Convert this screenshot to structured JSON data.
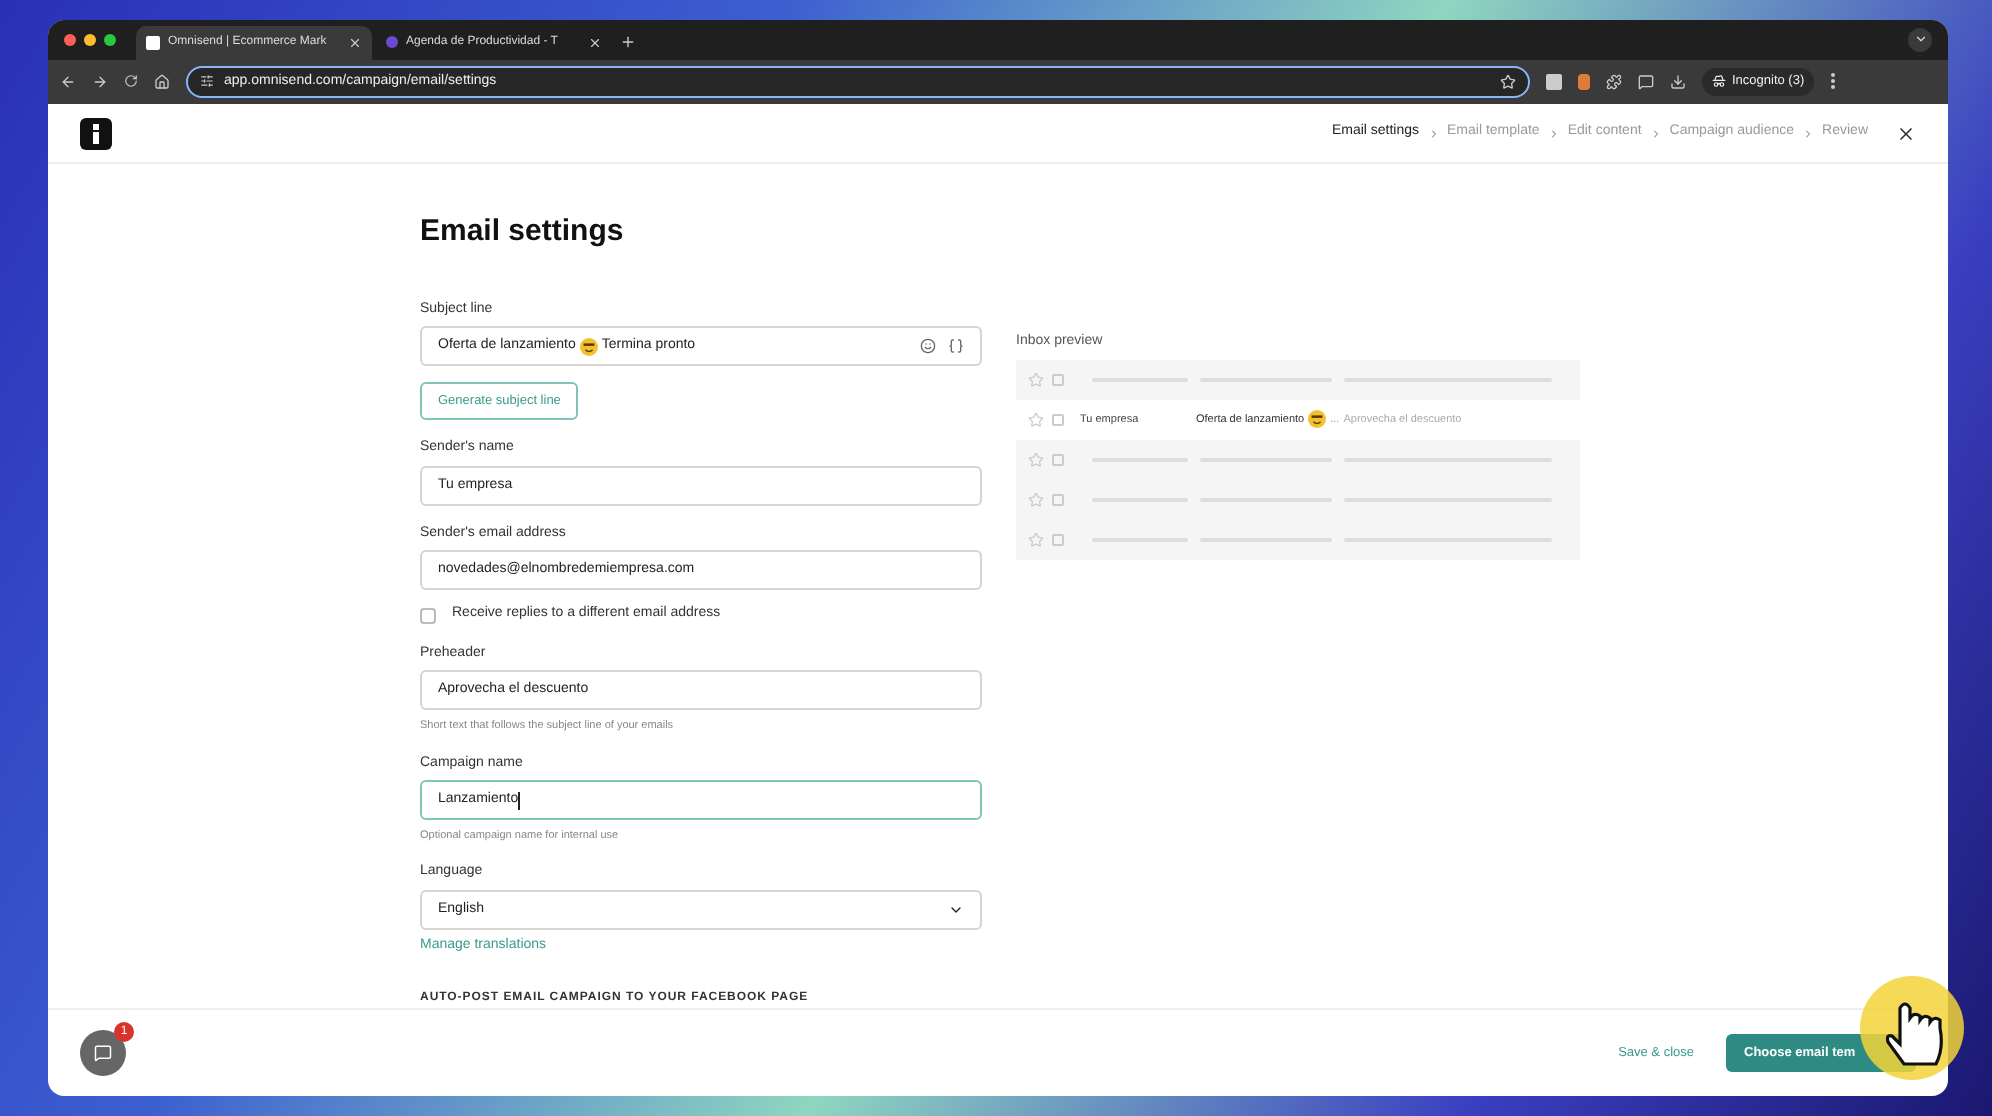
{
  "browser": {
    "tabs": [
      {
        "title": "Omnisend | Ecommerce Mark",
        "selected": true,
        "kind": "logo"
      },
      {
        "title": "Agenda de Productividad - T",
        "selected": false,
        "kind": "dot"
      }
    ],
    "url": "app.omnisend.com/campaign/email/settings",
    "profile": "Incognito (3)"
  },
  "steps": [
    {
      "label": "Email settings",
      "selected": true
    },
    {
      "label": "Email template",
      "selected": false
    },
    {
      "label": "Edit content",
      "selected": false
    },
    {
      "label": "Campaign audience",
      "selected": false
    },
    {
      "label": "Review",
      "selected": false
    }
  ],
  "title": "Email settings",
  "subject": {
    "label": "Subject line",
    "value_before": "Oferta de lanzamiento",
    "value_after": "Termina pronto",
    "generate": "Generate subject line"
  },
  "fields": [
    {
      "kind": "input",
      "label": "Sender's name",
      "value": "Tu empresa",
      "focused": false
    },
    {
      "kind": "input",
      "label": "Sender's email address",
      "value": "novedades@elnombredemiempresa.com",
      "focused": false
    },
    {
      "kind": "checkbox",
      "label": "Receive replies to a different email address",
      "checked": false
    },
    {
      "kind": "input",
      "label": "Preheader",
      "value": "Aprovecha el descuento",
      "help": "Short text that follows the subject line of your emails",
      "focused": false
    },
    {
      "kind": "input",
      "label": "Campaign name",
      "value": "Lanzamiento",
      "help": "Optional campaign name for internal use",
      "focused": true
    },
    {
      "kind": "select",
      "label": "Language",
      "value": "English",
      "link": "Manage translations"
    }
  ],
  "section_heading": "AUTO-POST EMAIL CAMPAIGN TO YOUR FACEBOOK PAGE",
  "inbox_preview": {
    "label": "Inbox preview",
    "rows": [
      {
        "kind": "placeholder"
      },
      {
        "kind": "email",
        "sender": "Tu empresa",
        "subject": "Oferta de lanzamiento",
        "ellipsis": "...",
        "preheader": "Aprovecha el descuento"
      },
      {
        "kind": "placeholder"
      },
      {
        "kind": "placeholder"
      },
      {
        "kind": "placeholder"
      }
    ]
  },
  "chat": {
    "badge": "1"
  },
  "footer": {
    "secondary": "Save & close",
    "primary": "Choose email tem"
  }
}
